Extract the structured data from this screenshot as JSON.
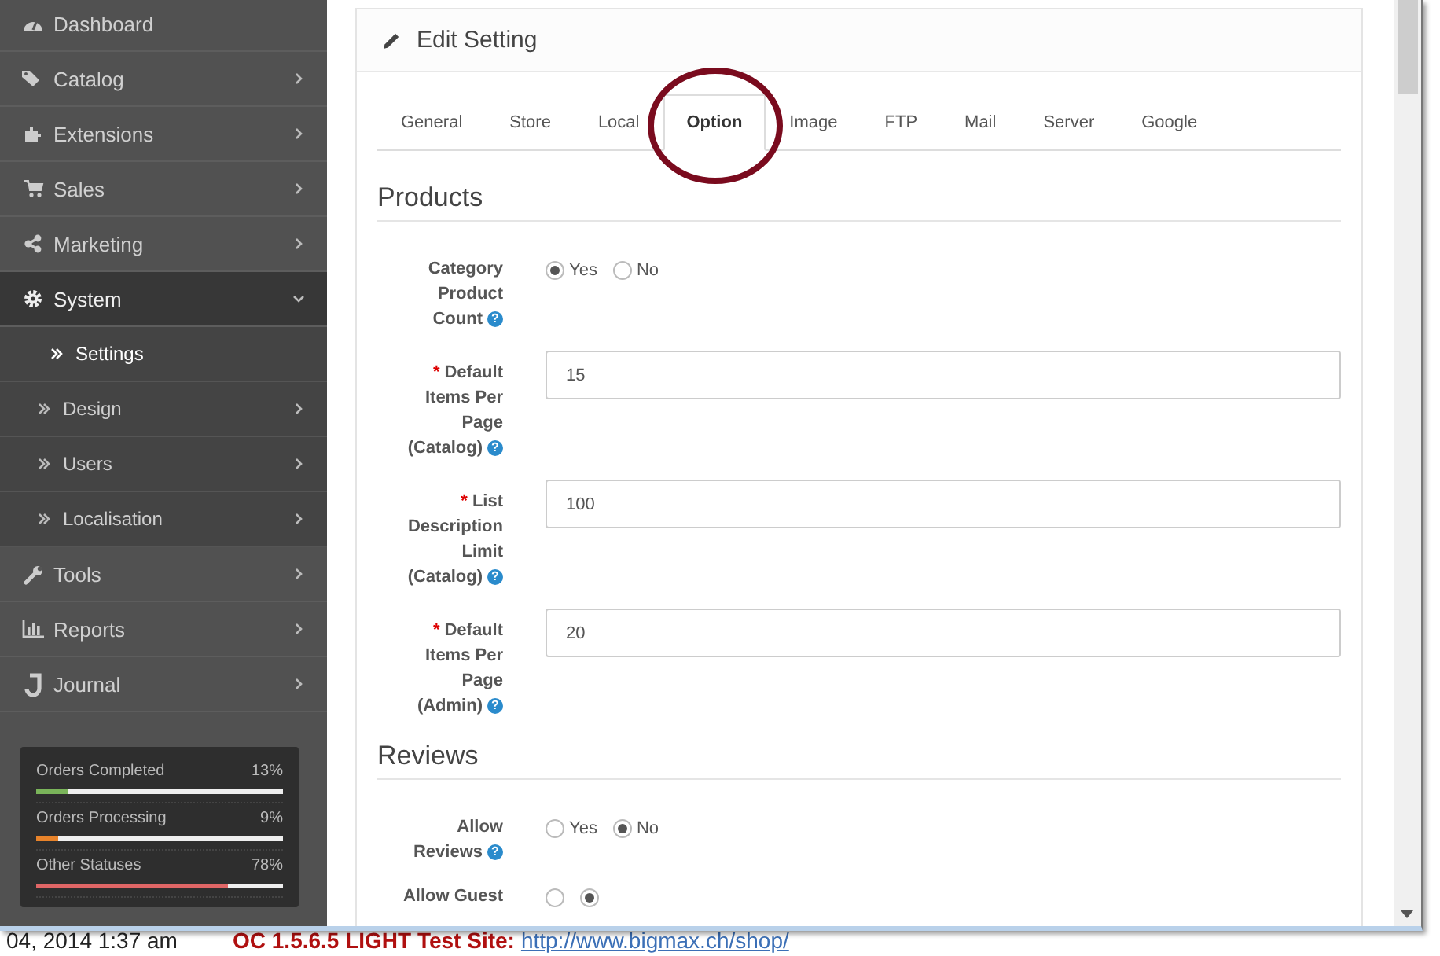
{
  "sidebar": {
    "items": [
      {
        "label": "Dashboard",
        "kind": "link",
        "selected": false
      },
      {
        "label": "Catalog",
        "kind": "menu",
        "expanded": false,
        "selected": false
      },
      {
        "label": "Extensions",
        "kind": "menu",
        "expanded": false,
        "selected": false
      },
      {
        "label": "Sales",
        "kind": "menu",
        "expanded": false,
        "selected": false
      },
      {
        "label": "Marketing",
        "kind": "menu",
        "expanded": false,
        "selected": false
      },
      {
        "label": "System",
        "kind": "menu",
        "expanded": true,
        "selected": true,
        "children": [
          {
            "label": "Settings",
            "kind": "link",
            "selected": true
          },
          {
            "label": "Design",
            "kind": "menu",
            "selected": false
          },
          {
            "label": "Users",
            "kind": "menu",
            "selected": false
          },
          {
            "label": "Localisation",
            "kind": "menu",
            "selected": false
          }
        ]
      },
      {
        "label": "Tools",
        "kind": "menu",
        "expanded": false,
        "selected": false
      },
      {
        "label": "Reports",
        "kind": "menu",
        "expanded": false,
        "selected": false
      },
      {
        "label": "Journal",
        "kind": "menu",
        "expanded": false,
        "selected": false
      }
    ],
    "stats": [
      {
        "label": "Orders Completed",
        "reading": "13%",
        "level": 0.13,
        "color": "#7ab45a"
      },
      {
        "label": "Orders Processing",
        "reading": "9%",
        "level": 0.09,
        "color": "#e8832a"
      },
      {
        "label": "Other Statuses",
        "reading": "78%",
        "level": 0.78,
        "color": "#e06666"
      }
    ]
  },
  "panel": {
    "title": "Edit Setting",
    "tabs": [
      {
        "label": "General",
        "selected": false
      },
      {
        "label": "Store",
        "selected": false
      },
      {
        "label": "Local",
        "selected": false
      },
      {
        "label": "Option",
        "selected": true
      },
      {
        "label": "Image",
        "selected": false
      },
      {
        "label": "FTP",
        "selected": false
      },
      {
        "label": "Mail",
        "selected": false
      },
      {
        "label": "Server",
        "selected": false
      },
      {
        "label": "Google",
        "selected": false
      }
    ],
    "sections": [
      {
        "title": "Products",
        "rows": [
          {
            "kind": "radio",
            "label": "Category Product Count",
            "help": "?",
            "options": [
              {
                "label": "Yes",
                "selected": true
              },
              {
                "label": "No",
                "selected": false
              }
            ]
          },
          {
            "kind": "text",
            "label": "Default Items Per Page (Catalog)",
            "required_mark": "*",
            "help": "?",
            "value": "15"
          },
          {
            "kind": "text",
            "label": "List Description Limit (Catalog)",
            "required_mark": "*",
            "help": "?",
            "value": "100"
          },
          {
            "kind": "text",
            "label": "Default Items Per Page (Admin)",
            "required_mark": "*",
            "help": "?",
            "value": "20"
          }
        ]
      },
      {
        "title": "Reviews",
        "rows": [
          {
            "kind": "radio",
            "label": "Allow Reviews",
            "help": "?",
            "options": [
              {
                "label": "Yes",
                "selected": false
              },
              {
                "label": "No",
                "selected": true
              }
            ]
          },
          {
            "kind": "radio",
            "label": "Allow Guest",
            "options": [
              {
                "selected": false
              },
              {
                "selected": true
              }
            ]
          }
        ]
      }
    ]
  },
  "background_page": {
    "date": "04, 2014 1:37 am",
    "site_label": "OC 1.5.6.5 LIGHT Test Site:",
    "site_link": "http://www.bigmax.ch/shop/"
  }
}
